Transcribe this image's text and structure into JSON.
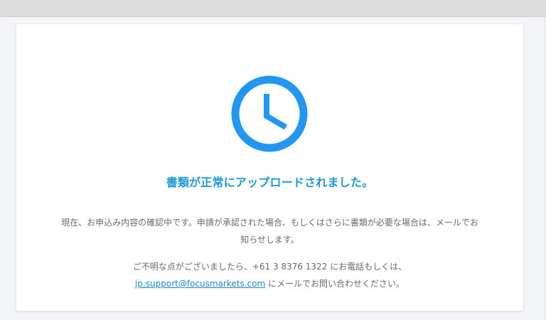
{
  "page": {
    "title": "書類が正常にアップロードされました。",
    "status_icon": "clock-icon",
    "message_line1": "現在、お申込み内容の確認中です。申請が承認された場合、もしくはさらに書類が必要な場合は、メールでお知らせします。",
    "contact_prefix": "ご不明な点がございましたら、+61 3 8376 1322 にお電話もしくは、",
    "contact_email": "jp.support@focusmarkets.com",
    "contact_suffix": " にメールでお問い合わせください。",
    "colors": {
      "accent": "#1f98d8",
      "icon": "#2196f3",
      "text": "#6b6b6b",
      "link": "#1f87c6"
    }
  }
}
